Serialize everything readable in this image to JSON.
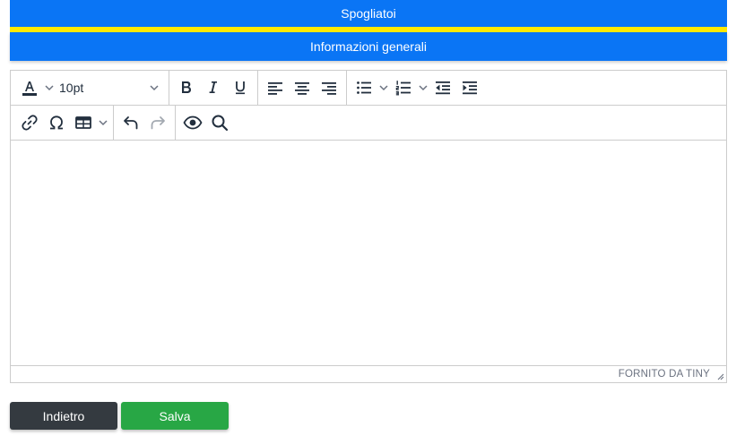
{
  "header": {
    "title": "Spogliatoi",
    "section": "Informazioni generali"
  },
  "colors": {
    "header_blue": "#0a75f5",
    "stripe_yellow": "#ffea00",
    "back_button": "#343a40",
    "save_button": "#28a745"
  },
  "toolbar": {
    "font_size": "10pt",
    "row1_icons": [
      "text-color-icon",
      "bold-icon",
      "italic-icon",
      "underline-icon",
      "align-left-icon",
      "align-center-icon",
      "align-right-icon",
      "bullet-list-icon",
      "numbered-list-icon",
      "outdent-icon",
      "indent-icon"
    ],
    "row2_icons": [
      "link-icon",
      "omega-icon",
      "table-icon",
      "undo-icon",
      "redo-icon",
      "preview-eye-icon",
      "search-icon"
    ]
  },
  "editor": {
    "content": "",
    "branding": "FORNITO DA TINY"
  },
  "actions": {
    "back_label": "Indietro",
    "save_label": "Salva"
  }
}
